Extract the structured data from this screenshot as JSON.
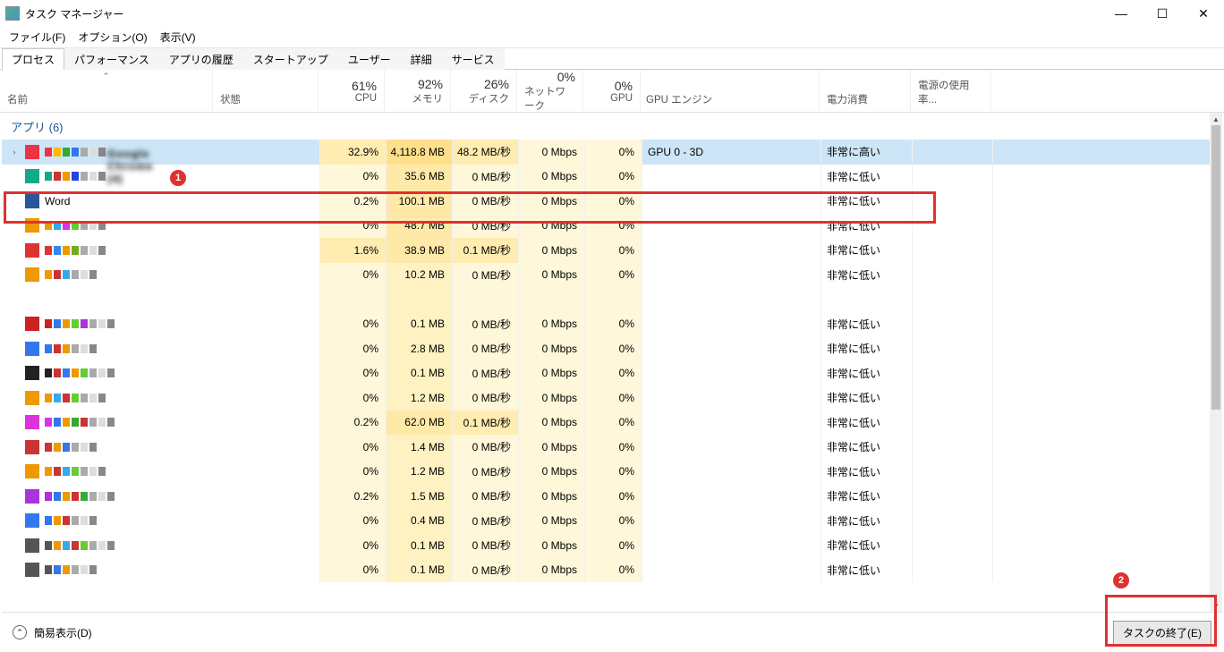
{
  "window": {
    "title": "タスク マネージャー"
  },
  "menu": {
    "file": "ファイル(F)",
    "options": "オプション(O)",
    "view": "表示(V)"
  },
  "tabs": [
    "プロセス",
    "パフォーマンス",
    "アプリの履歴",
    "スタートアップ",
    "ユーザー",
    "詳細",
    "サービス"
  ],
  "columns": {
    "name": "名前",
    "status": "状態",
    "cpu_pct": "61%",
    "cpu": "CPU",
    "mem_pct": "92%",
    "mem": "メモリ",
    "disk_pct": "26%",
    "disk": "ディスク",
    "net_pct": "0%",
    "net": "ネットワーク",
    "gpu_pct": "0%",
    "gpu": "GPU",
    "gpu_engine": "GPU エンジン",
    "power": "電力消費",
    "power_trend": "電源の使用率..."
  },
  "group": {
    "apps_label": "アプリ (6)"
  },
  "rows": [
    {
      "name": "Google Chrome (4)",
      "expand": true,
      "blur": true,
      "iconColors": [
        "#e34",
        "#fb0",
        "#3a3",
        "#37e"
      ],
      "cpu": "32.9%",
      "cpu_lvl": "med",
      "mem": "4,118.8 MB",
      "mem_lvl": "high",
      "disk": "48.2 MB/秒",
      "disk_lvl": "med",
      "net": "0 Mbps",
      "gpu": "0%",
      "gpu_engine": "GPU 0 - 3D",
      "power": "非常に高い",
      "selected": true
    },
    {
      "name": "",
      "blur": true,
      "iconColors": [
        "#1a8",
        "#c33",
        "#e90",
        "#24d"
      ],
      "cpu": "0%",
      "mem": "35.6 MB",
      "mem_lvl": "med",
      "disk": "0 MB/秒",
      "net": "0 Mbps",
      "gpu": "0%",
      "power": "非常に低い"
    },
    {
      "name": "Word",
      "icon": "word",
      "cpu": "0.2%",
      "mem": "100.1 MB",
      "mem_lvl": "med",
      "disk": "0 MB/秒",
      "net": "0 Mbps",
      "gpu": "0%",
      "power": "非常に低い"
    },
    {
      "name": "",
      "blur": true,
      "iconColors": [
        "#e90",
        "#3ae",
        "#d3d",
        "#6c3"
      ],
      "cpu": "0%",
      "mem": "48.7 MB",
      "mem_lvl": "med",
      "disk": "0 MB/秒",
      "net": "0 Mbps",
      "gpu": "0%",
      "power": "非常に低い"
    },
    {
      "name": "",
      "blur": true,
      "iconColors": [
        "#d33",
        "#38e",
        "#e90",
        "#7a2"
      ],
      "cpu": "1.6%",
      "cpu_lvl": "med",
      "mem": "38.9 MB",
      "mem_lvl": "med",
      "disk": "0.1 MB/秒",
      "disk_lvl": "med",
      "net": "0 Mbps",
      "gpu": "0%",
      "power": "非常に低い"
    },
    {
      "name": "",
      "blur": true,
      "iconColors": [
        "#e90",
        "#c33",
        "#3ae"
      ],
      "cpu": "0%",
      "mem": "10.2 MB",
      "disk": "0 MB/秒",
      "net": "0 Mbps",
      "gpu": "0%",
      "power": "非常に低い"
    },
    {
      "spacer": true
    },
    {
      "name": "",
      "blur": true,
      "iconColors": [
        "#c22",
        "#37e",
        "#e90",
        "#6c3",
        "#a3d"
      ],
      "cpu": "0%",
      "mem": "0.1 MB",
      "disk": "0 MB/秒",
      "net": "0 Mbps",
      "gpu": "0%",
      "power": "非常に低い"
    },
    {
      "name": "",
      "blur": true,
      "iconColors": [
        "#37e",
        "#c33",
        "#e90"
      ],
      "cpu": "0%",
      "mem": "2.8 MB",
      "disk": "0 MB/秒",
      "net": "0 Mbps",
      "gpu": "0%",
      "power": "非常に低い"
    },
    {
      "name": "",
      "blur": true,
      "iconColors": [
        "#222",
        "#c33",
        "#37e",
        "#e90",
        "#6c3"
      ],
      "cpu": "0%",
      "mem": "0.1 MB",
      "disk": "0 MB/秒",
      "net": "0 Mbps",
      "gpu": "0%",
      "power": "非常に低い"
    },
    {
      "name": "",
      "blur": true,
      "iconColors": [
        "#e90",
        "#3ae",
        "#c33",
        "#6c3"
      ],
      "cpu": "0%",
      "mem": "1.2 MB",
      "disk": "0 MB/秒",
      "net": "0 Mbps",
      "gpu": "0%",
      "power": "非常に低い"
    },
    {
      "name": "",
      "blur": true,
      "iconColors": [
        "#d3d",
        "#37e",
        "#e90",
        "#3a3",
        "#c33"
      ],
      "cpu": "0.2%",
      "mem": "62.0 MB",
      "mem_lvl": "med",
      "disk": "0.1 MB/秒",
      "disk_lvl": "med",
      "net": "0 Mbps",
      "gpu": "0%",
      "power": "非常に低い"
    },
    {
      "name": "",
      "blur": true,
      "iconColors": [
        "#c33",
        "#e90",
        "#37e"
      ],
      "cpu": "0%",
      "mem": "1.4 MB",
      "disk": "0 MB/秒",
      "net": "0 Mbps",
      "gpu": "0%",
      "power": "非常に低い"
    },
    {
      "name": "",
      "blur": true,
      "iconColors": [
        "#e90",
        "#c33",
        "#3ae",
        "#6c3"
      ],
      "cpu": "0%",
      "mem": "1.2 MB",
      "disk": "0 MB/秒",
      "net": "0 Mbps",
      "gpu": "0%",
      "power": "非常に低い"
    },
    {
      "name": "",
      "blur": true,
      "iconColors": [
        "#a3d",
        "#37e",
        "#e90",
        "#c33",
        "#3a3"
      ],
      "cpu": "0.2%",
      "mem": "1.5 MB",
      "disk": "0 MB/秒",
      "net": "0 Mbps",
      "gpu": "0%",
      "power": "非常に低い"
    },
    {
      "name": "",
      "blur": true,
      "iconColors": [
        "#37e",
        "#e90",
        "#c33"
      ],
      "cpu": "0%",
      "mem": "0.4 MB",
      "disk": "0 MB/秒",
      "net": "0 Mbps",
      "gpu": "0%",
      "power": "非常に低い"
    },
    {
      "name": "",
      "blur": true,
      "iconColors": [
        "#555",
        "#e90",
        "#3ae",
        "#c33",
        "#6c3"
      ],
      "cpu": "0%",
      "mem": "0.1 MB",
      "disk": "0 MB/秒",
      "net": "0 Mbps",
      "gpu": "0%",
      "power": "非常に低い"
    },
    {
      "name": "",
      "blur": true,
      "iconColors": [
        "#555",
        "#37e",
        "#e90"
      ],
      "cpu": "0%",
      "mem": "0.1 MB",
      "disk": "0 MB/秒",
      "net": "0 Mbps",
      "gpu": "0%",
      "power": "非常に低い"
    }
  ],
  "footer": {
    "fewer_details": "簡易表示(D)",
    "end_task": "タスクの終了(E)"
  },
  "annotations": {
    "badge1": "1",
    "badge2": "2"
  }
}
